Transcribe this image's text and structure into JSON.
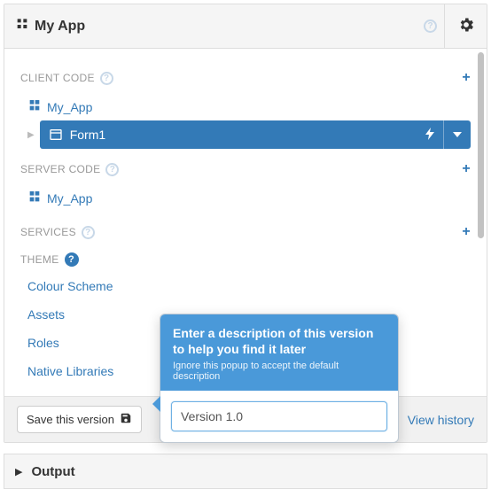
{
  "header": {
    "title": "My App"
  },
  "sections": {
    "client_code": {
      "label": "CLIENT CODE",
      "module": "My_App",
      "form": "Form1"
    },
    "server_code": {
      "label": "SERVER CODE",
      "module": "My_App"
    },
    "services": {
      "label": "SERVICES"
    },
    "theme": {
      "label": "THEME",
      "items": [
        "Colour Scheme",
        "Assets",
        "Roles",
        "Native Libraries"
      ]
    }
  },
  "footer": {
    "save_label": "Save this version",
    "history_label": "View history"
  },
  "popover": {
    "title": "Enter a description of this version to help you find it later",
    "subtitle": "Ignore this popup to accept the default description",
    "value": "Version 1.0"
  },
  "output": {
    "label": "Output"
  }
}
